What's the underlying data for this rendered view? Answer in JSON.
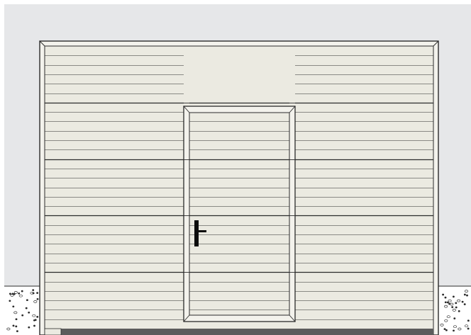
{
  "scene": {
    "wall_color": "#e6e7e9",
    "door_panel_color": "#ebeae1",
    "frame_color": "#f3f2ec",
    "line_color": "#2b2b2b",
    "ground_color": "#ffffff",
    "threshold_color": "#5c5c5c",
    "handle_color": "#0d0d0d",
    "wicket_door_present": true,
    "sectional_panels": 5,
    "grooves_per_panel": 5
  }
}
